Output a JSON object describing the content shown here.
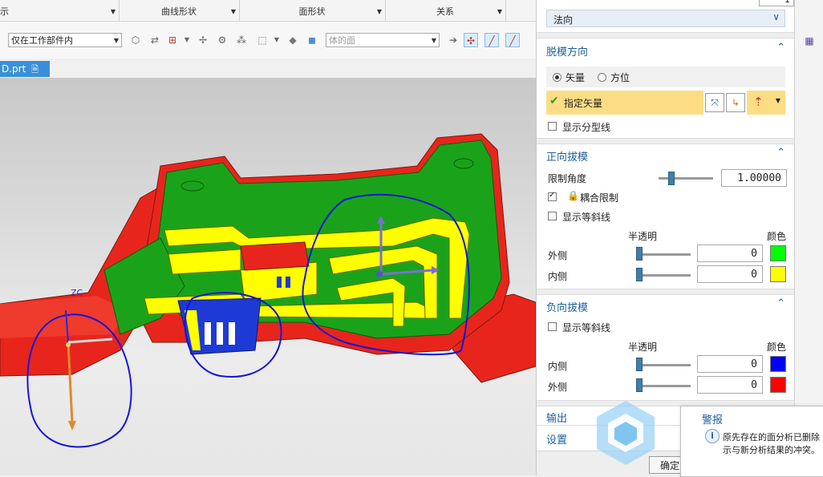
{
  "ribbon": {
    "groups": [
      {
        "label": "示",
        "has_dropdown": true
      },
      {
        "label": "曲线形状",
        "has_dropdown": true
      },
      {
        "label": "面形状",
        "has_dropdown": true
      },
      {
        "label": "关系",
        "has_dropdown": true
      }
    ]
  },
  "toolbar": {
    "scope_combo": "仅在工作部件内",
    "face_filter_combo": "体的面"
  },
  "file_tab": {
    "name": "D.prt"
  },
  "viewport": {
    "axis_label": "ZC"
  },
  "panel": {
    "top_field": "1",
    "direction_select": "法向",
    "draft_direction": {
      "title": "脱模方向",
      "radio_vector": "矢量",
      "radio_orientation": "方位",
      "selected": "矢量",
      "specify_vector": "指定矢量",
      "show_parting_line": "显示分型线",
      "show_parting_line_checked": false
    },
    "positive_draft": {
      "title": "正向拔模",
      "limit_angle_label": "限制角度",
      "limit_angle_value": "1.00000",
      "couple_limit": "耦合限制",
      "couple_limit_checked": true,
      "show_isocline": "显示等斜线",
      "show_isocline_checked": false,
      "transparency_header": "半透明",
      "color_header": "颜色",
      "rows": [
        {
          "label": "外侧",
          "transparency": "0",
          "color": "#00ff00"
        },
        {
          "label": "内侧",
          "transparency": "0",
          "color": "#ffff00"
        }
      ]
    },
    "negative_draft": {
      "title": "负向拔模",
      "show_isocline": "显示等斜线",
      "show_isocline_checked": false,
      "transparency_header": "半透明",
      "color_header": "颜色",
      "rows": [
        {
          "label": "内侧",
          "transparency": "0",
          "color": "#0000ff"
        },
        {
          "label": "外侧",
          "transparency": "0",
          "color": "#ff0000"
        }
      ]
    },
    "output_label": "输出",
    "settings_label": "设置",
    "ok_button": "确定"
  },
  "tooltip": {
    "title": "警报",
    "message": "原先存在的面分析已删除",
    "message2": "示与新分析结果的冲突。"
  }
}
